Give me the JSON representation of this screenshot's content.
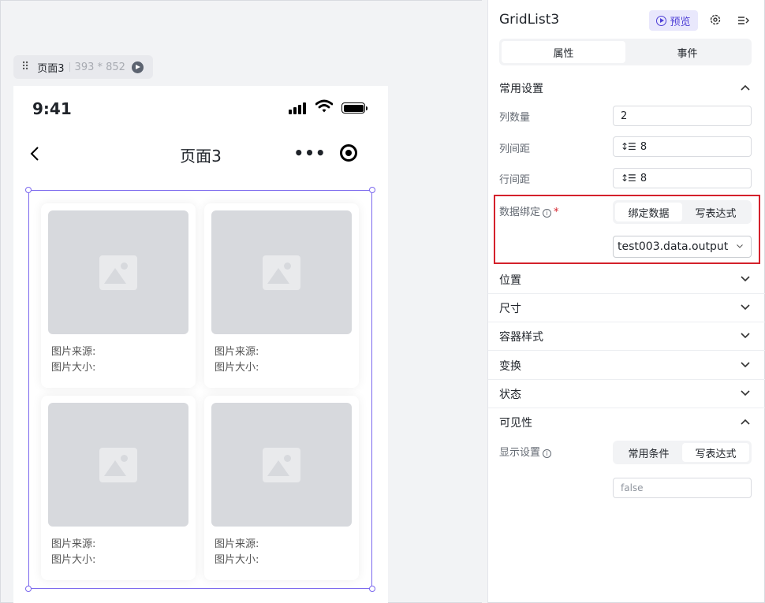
{
  "page_tag": {
    "name": "页面3",
    "size": "393 * 852"
  },
  "phone": {
    "time": "9:41",
    "nav_title": "页面3",
    "capsule_more": "•••"
  },
  "grid": {
    "items": [
      {
        "source_label": "图片来源:",
        "size_label": "图片大小:"
      },
      {
        "source_label": "图片来源:",
        "size_label": "图片大小:"
      },
      {
        "source_label": "图片来源:",
        "size_label": "图片大小:"
      },
      {
        "source_label": "图片来源:",
        "size_label": "图片大小:"
      }
    ]
  },
  "panel": {
    "component_name": "GridList3",
    "preview_label": "预览",
    "tabs": [
      "属性",
      "事件"
    ],
    "active_tab": "属性",
    "common_section": "常用设置",
    "columns_label": "列数量",
    "columns_value": "2",
    "col_gap_label": "列间距",
    "col_gap_value": "8",
    "row_gap_label": "行间距",
    "row_gap_value": "8",
    "binding_label": "数据绑定",
    "binding_modes": [
      "绑定数据",
      "写表达式"
    ],
    "binding_active": "绑定数据",
    "binding_value": "test003.data.output",
    "sections": [
      "位置",
      "尺寸",
      "容器样式",
      "变换",
      "状态"
    ],
    "visibility_section": "可见性",
    "display_label": "显示设置",
    "display_modes": [
      "常用条件",
      "写表达式"
    ],
    "display_active": "写表达式",
    "display_placeholder": "false"
  },
  "colors": {
    "accent": "#7b68ee",
    "highlight": "#d4212b",
    "brand": "#4e3fd6"
  }
}
